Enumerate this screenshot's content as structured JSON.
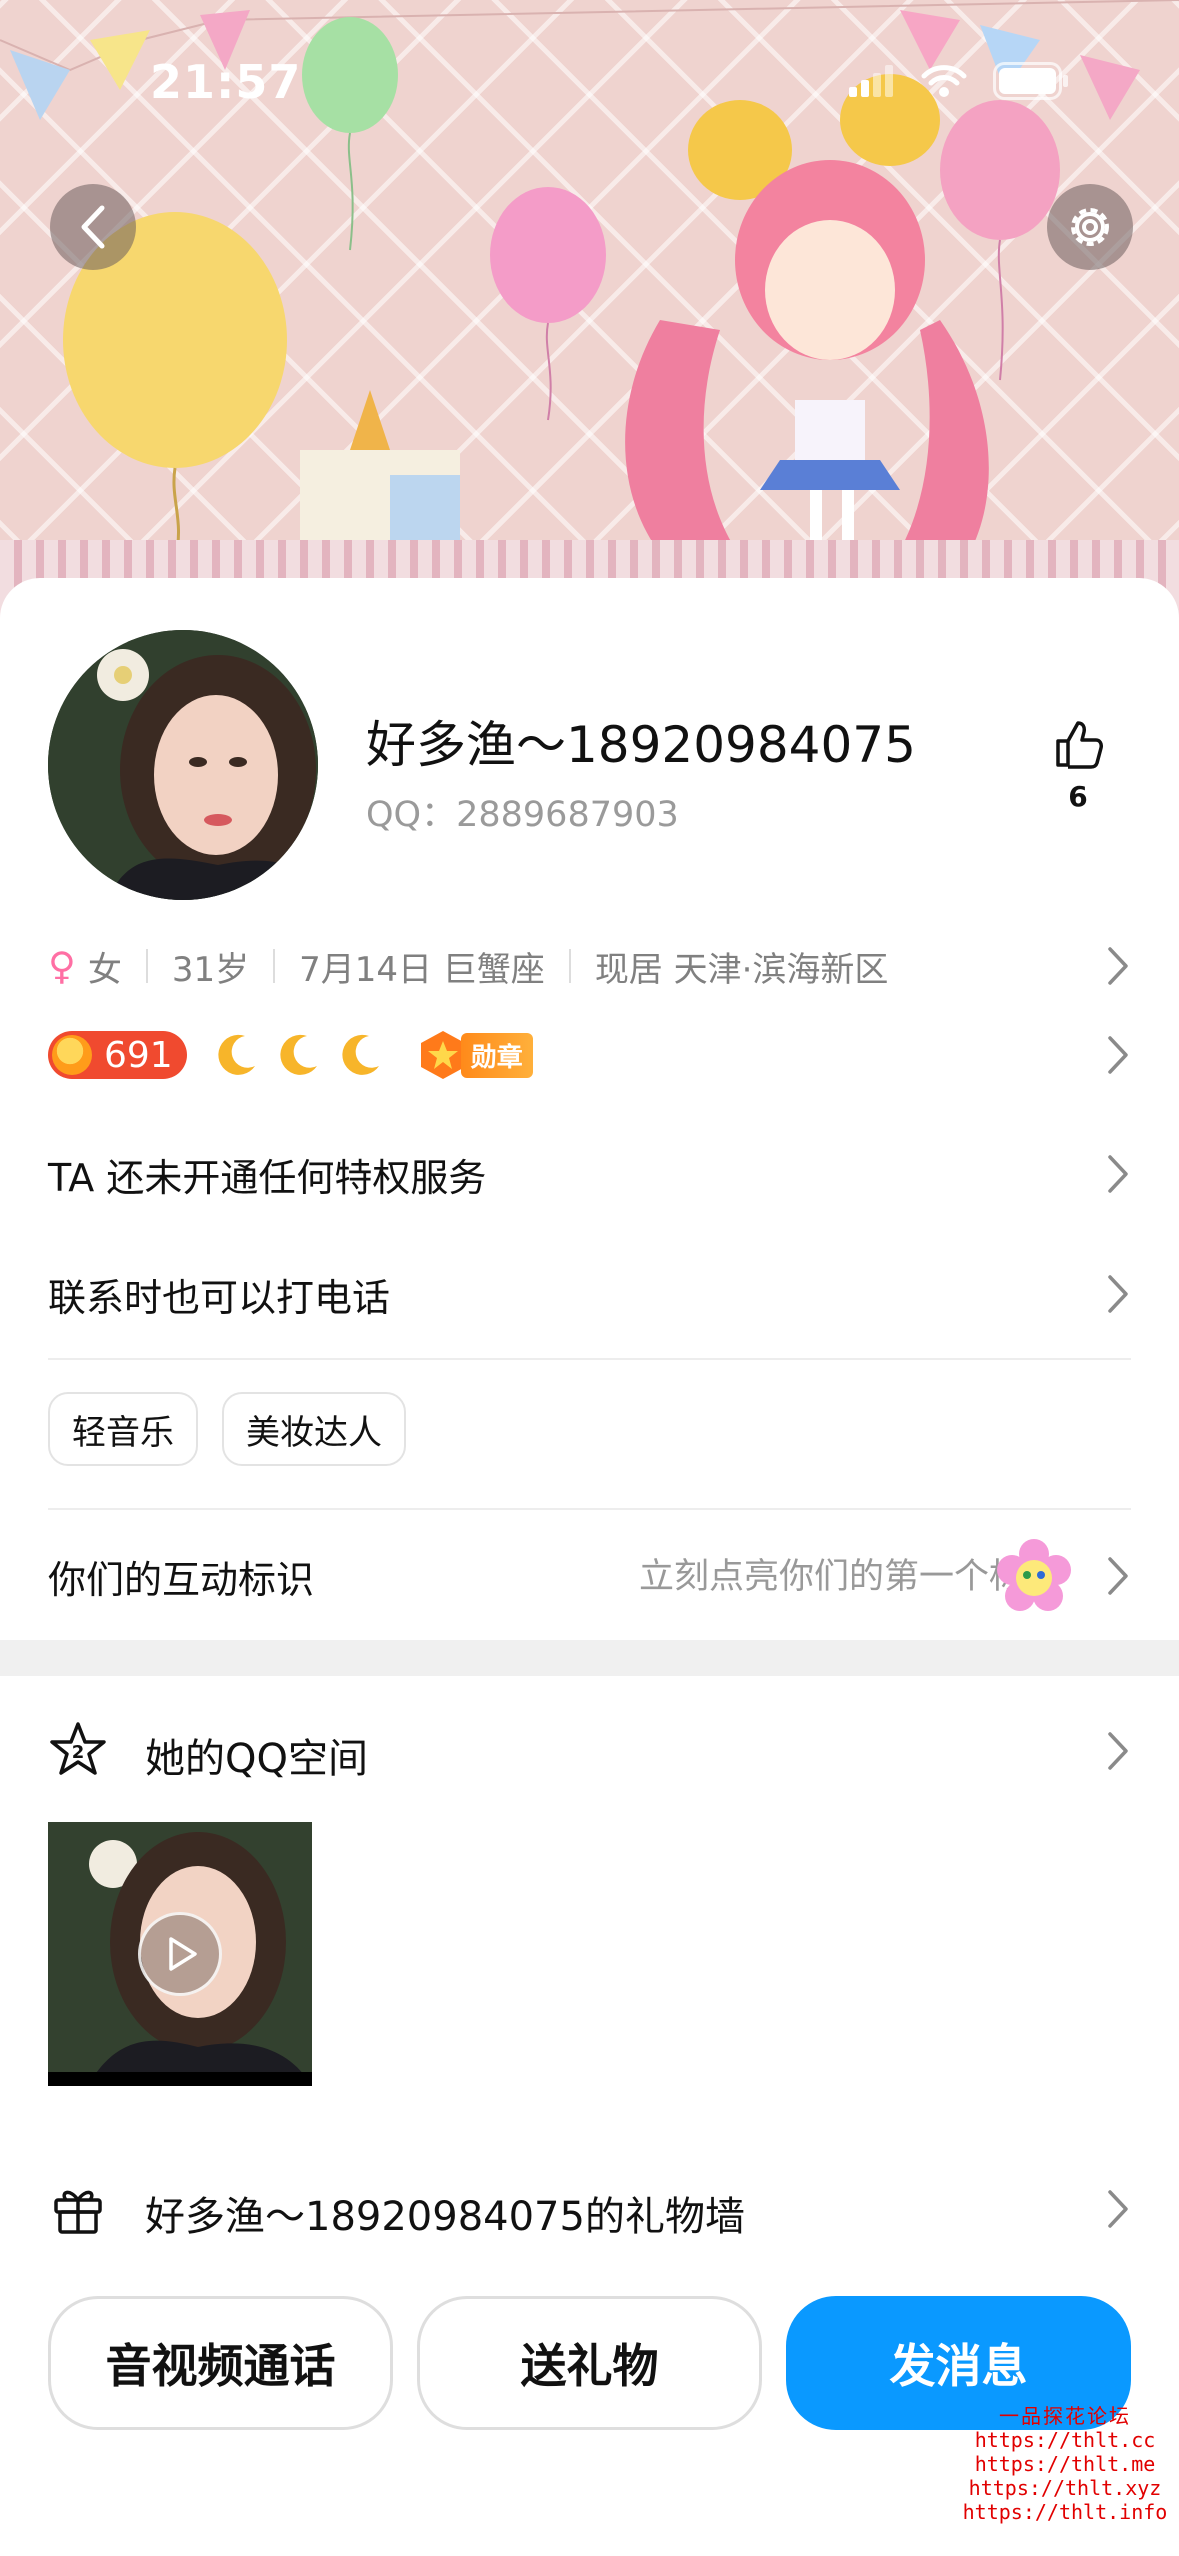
{
  "status_bar": {
    "time": "21:57"
  },
  "profile": {
    "nickname": "好多渔～18920984075",
    "qq_label": "QQ：2889687903",
    "like_count": "6",
    "gender_symbol": "♀",
    "gender": "女",
    "age": "31岁",
    "birthday": "7月14日 巨蟹座",
    "location": "现居 天津·滨海新区"
  },
  "badges": {
    "level_number": "691",
    "medal_label": "勋章"
  },
  "rows": {
    "privilege": "TA 还未开通任何特权服务",
    "phone_hint": "联系时也可以打电话"
  },
  "tags": [
    "轻音乐",
    "美妆达人"
  ],
  "interaction": {
    "title": "你们的互动标识",
    "hint": "立刻点亮你们的第一个标识"
  },
  "qzone": {
    "title": "她的QQ空间",
    "badge": "2"
  },
  "gift_wall": {
    "title": "好多渔～18920984075的礼物墙"
  },
  "actions": {
    "call": "音视频通话",
    "gift": "送礼物",
    "message": "发消息"
  },
  "watermark": {
    "title": "一品探花论坛",
    "lines": [
      "https://thlt.cc",
      "https://thlt.me",
      "https://thlt.xyz",
      "https://thlt.info"
    ]
  },
  "colors": {
    "accent": "#0A99FF",
    "coin": "#F04A2F",
    "female": "#FF6FA4"
  }
}
